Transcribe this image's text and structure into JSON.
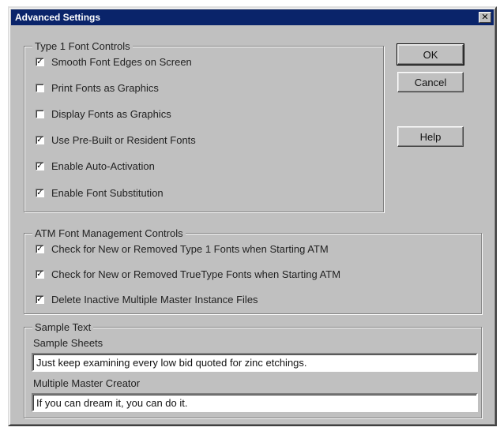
{
  "window": {
    "title": "Advanced Settings",
    "close_glyph": "✕"
  },
  "type1_group": {
    "title": "Type 1 Font Controls",
    "options": [
      {
        "label": "Smooth Font Edges on Screen",
        "checked": true
      },
      {
        "label": "Print Fonts as Graphics",
        "checked": false
      },
      {
        "label": "Display Fonts as Graphics",
        "checked": false
      },
      {
        "label": "Use Pre-Built or Resident Fonts",
        "checked": true
      },
      {
        "label": "Enable Auto-Activation",
        "checked": true
      },
      {
        "label": "Enable Font Substitution",
        "checked": true
      }
    ]
  },
  "buttons": {
    "ok": "OK",
    "cancel": "Cancel",
    "help": "Help"
  },
  "atm_group": {
    "title": "ATM Font Management Controls",
    "options": [
      {
        "label": "Check for New or Removed Type 1 Fonts when Starting ATM",
        "checked": true
      },
      {
        "label": "Check for New or Removed TrueType Fonts when Starting ATM",
        "checked": true
      },
      {
        "label": "Delete Inactive Multiple Master Instance Files",
        "checked": true
      }
    ]
  },
  "sample_group": {
    "title": "Sample Text",
    "sample_sheets_label": "Sample Sheets",
    "sample_sheets_value": "Just keep examining every low bid quoted for zinc etchings.",
    "mm_creator_label": "Multiple Master Creator",
    "mm_creator_value": "If you can dream it, you can do it."
  },
  "check_glyph": "✓"
}
